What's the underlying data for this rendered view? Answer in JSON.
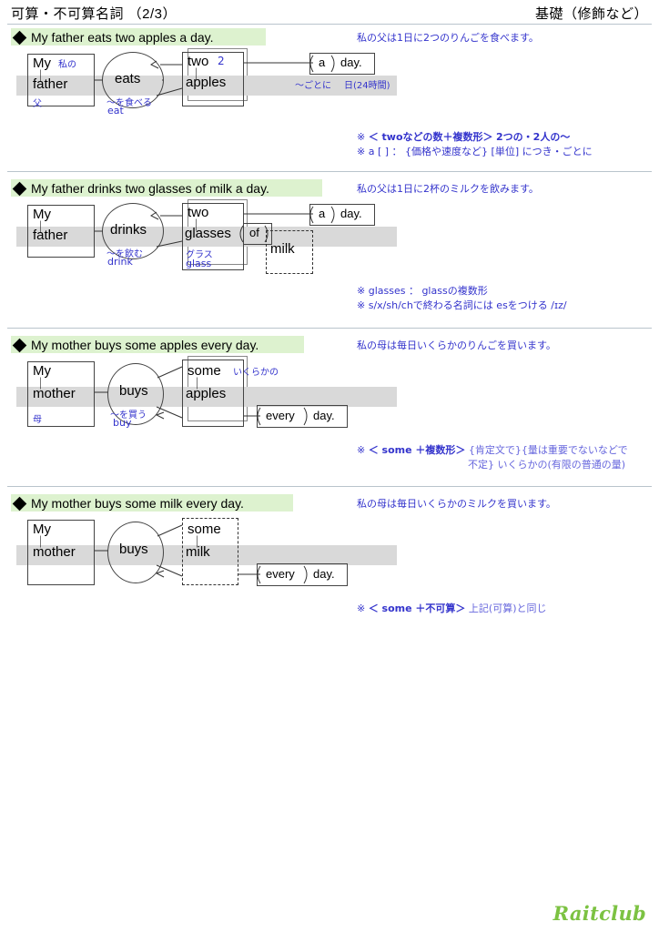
{
  "header": {
    "left_title": "可算・不可算名詞 （2/3）",
    "right_title": "基礎（修飾など）"
  },
  "footer": {
    "logo_text": "Raitclub"
  },
  "sections": [
    {
      "id": "sec1",
      "title": "My father eats two apples a day.",
      "translation": "私の父は1日に2つのりんごを食べます。",
      "diagram": {
        "subject_top": "My",
        "subject_top_jp": "私の",
        "subject_main": "father",
        "subject_main_jp": "父",
        "verb": "eats",
        "verb_jp": "〜を食べる",
        "verb_en": "eat",
        "object_top": "two",
        "object_top_num": "2",
        "object_main": "apples",
        "adverb_pre": "a",
        "adverb_main": "day.",
        "adverb_jp1": "〜ごとに",
        "adverb_jp2": "日(24時間)"
      },
      "notes": [
        {
          "mark": "※",
          "bold": "＜ twoなどの数＋複数形＞",
          "rest": "  2つの・2人の〜"
        },
        {
          "mark": "※",
          "bold": "",
          "rest": "a [ ] ： {価格や速度など} [単位] につき・ごとに"
        }
      ]
    },
    {
      "id": "sec2",
      "title": "My father drinks two glasses of milk a day.",
      "translation": "私の父は1日に2杯のミルクを飲みます。",
      "diagram": {
        "subject_top": "My",
        "subject_main": "father",
        "verb": "drinks",
        "verb_jp": "〜を飲む",
        "verb_en": "drink",
        "object_top": "two",
        "object_main": "glasses",
        "object_jp": "グラス",
        "object_en": "glass",
        "prep": "of",
        "prep_object": "milk",
        "adverb_pre": "a",
        "adverb_main": "day."
      },
      "notes": [
        {
          "mark": "※",
          "bold": "",
          "rest": "glasses ：  glassの複数形"
        },
        {
          "mark": "※",
          "bold": "",
          "rest": "s/x/sh/chで終わる名詞には esをつける /ɪz/"
        }
      ]
    },
    {
      "id": "sec3",
      "title": "My mother buys some apples every day.",
      "translation": "私の母は毎日いくらかのりんごを買います。",
      "diagram": {
        "subject_top": "My",
        "subject_main": "mother",
        "subject_main_jp": "母",
        "verb": "buys",
        "verb_jp": "〜を買う",
        "verb_en": "buy",
        "object_top": "some",
        "object_top_jp": "いくらかの",
        "object_main": "apples",
        "adverb_pre": "every",
        "adverb_main": "day."
      },
      "notes": [
        {
          "mark": "※",
          "bold": "＜ some ＋複数形＞",
          "rest": "  {肯定文で}{量は重要でないなどで"
        },
        {
          "mark": "",
          "bold": "",
          "rest": "不定} いくらかの(有限の普通の量)"
        }
      ]
    },
    {
      "id": "sec4",
      "title": "My mother buys some milk every day.",
      "translation": "私の母は毎日いくらかのミルクを買います。",
      "diagram": {
        "subject_top": "My",
        "subject_main": "mother",
        "verb": "buys",
        "object_top": "some",
        "object_main": "milk",
        "adverb_pre": "every",
        "adverb_main": "day."
      },
      "notes": [
        {
          "mark": "※",
          "bold": "＜ some ＋不可算＞",
          "rest": "  上記(可算)と同じ"
        }
      ]
    }
  ]
}
